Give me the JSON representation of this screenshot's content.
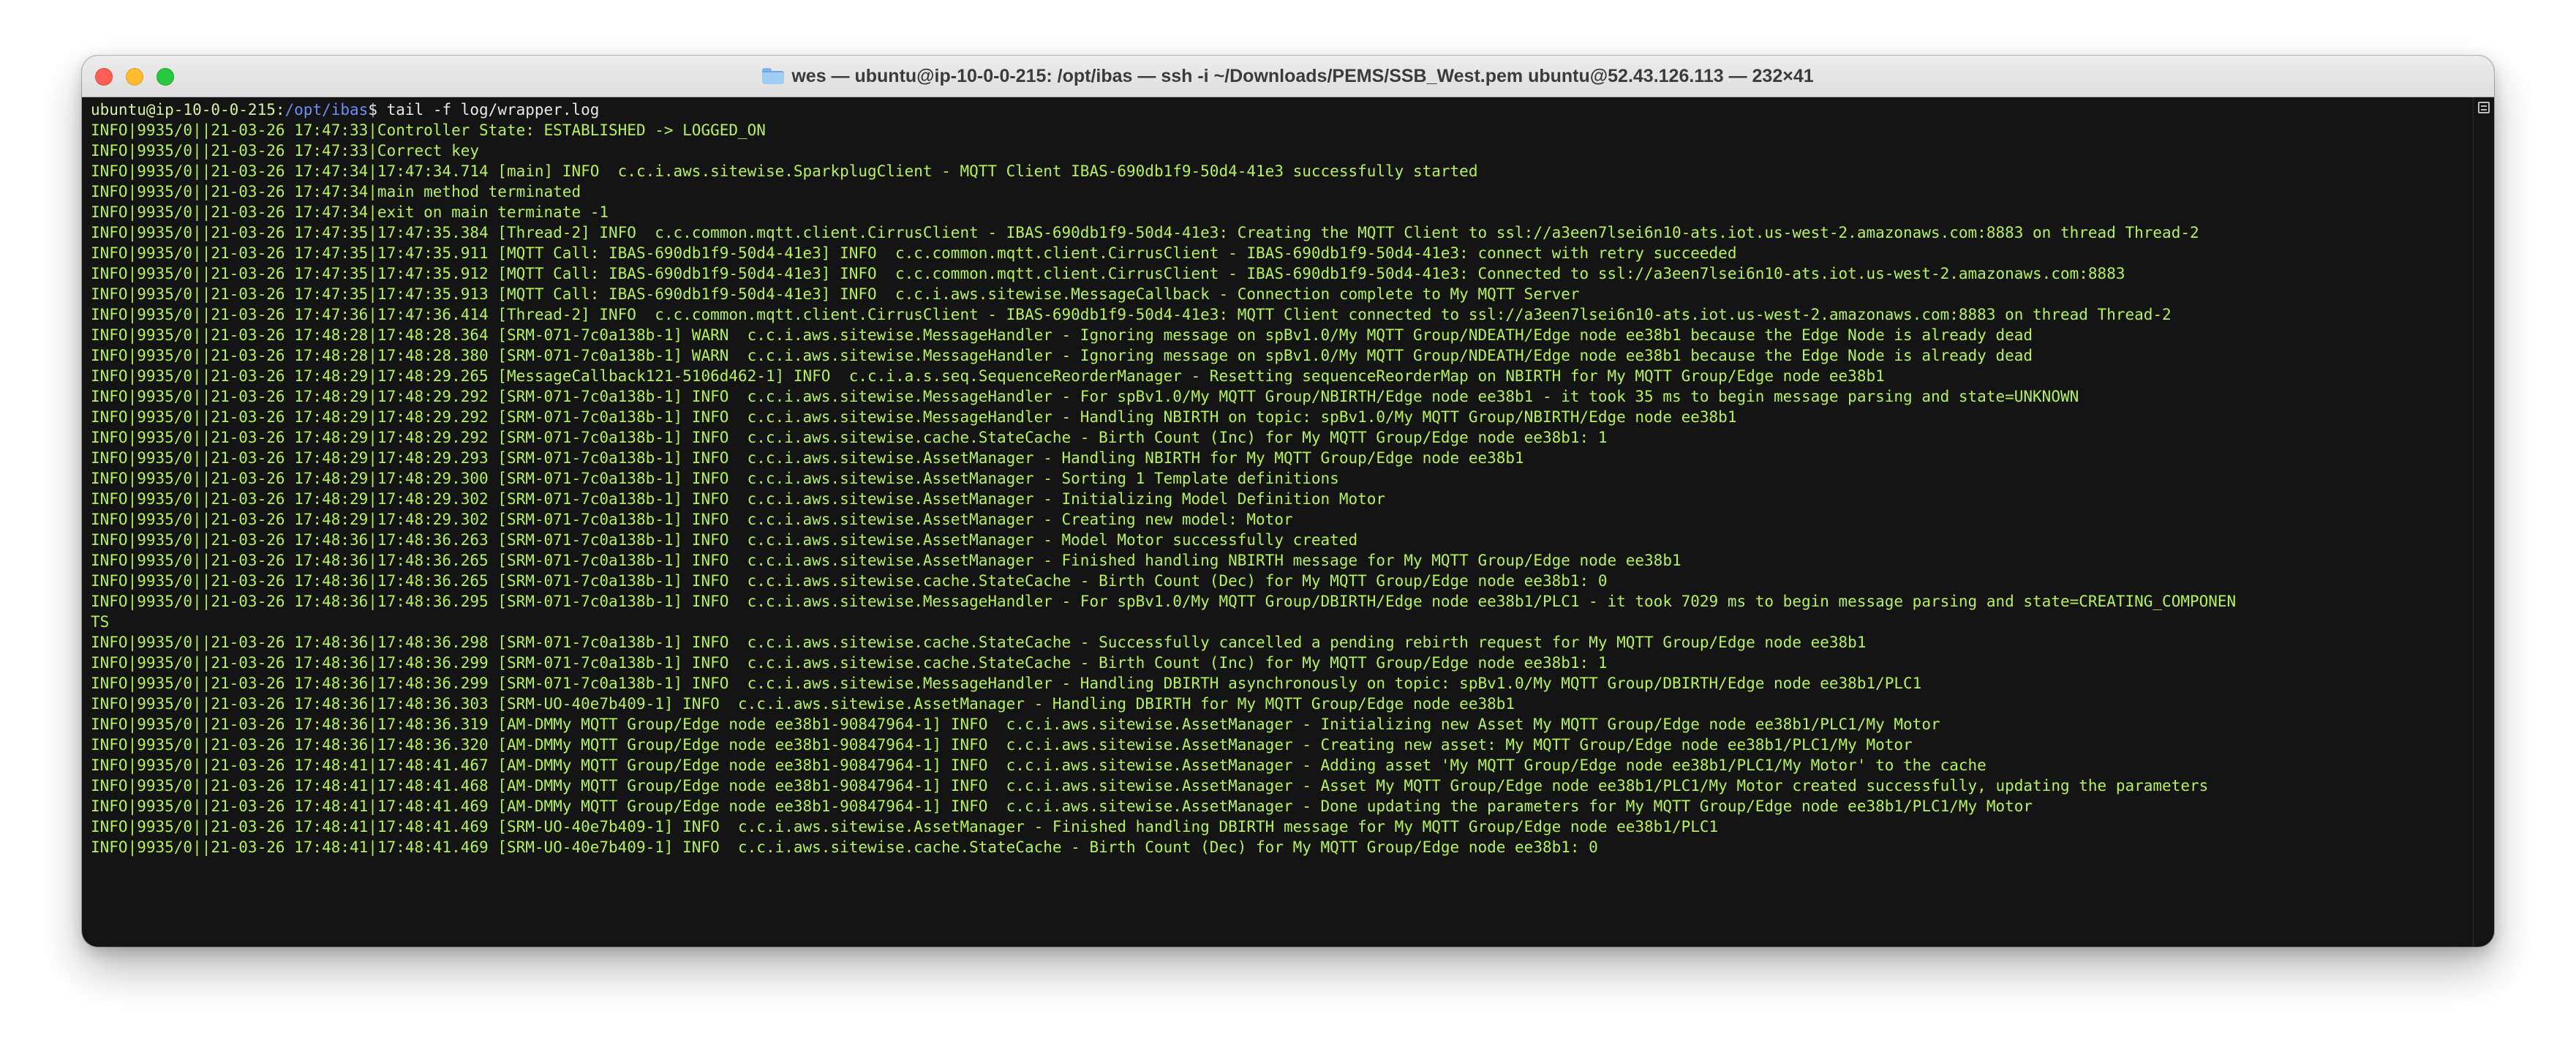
{
  "window": {
    "title": "wes — ubuntu@ip-10-0-0-215: /opt/ibas — ssh -i ~/Downloads/PEMS/SSB_West.pem ubuntu@52.43.126.113 — 232×41"
  },
  "terminal": {
    "prompt": {
      "user_host": "ubuntu@ip-10-0-0-215:",
      "path": "/opt/ibas",
      "symbol": "$",
      "command": " tail -f log/wrapper.log"
    },
    "lines": [
      "INFO|9935/0||21-03-26 17:47:33|Controller State: ESTABLISHED -> LOGGED_ON",
      "INFO|9935/0||21-03-26 17:47:33|Correct key",
      "INFO|9935/0||21-03-26 17:47:34|17:47:34.714 [main] INFO  c.c.i.aws.sitewise.SparkplugClient - MQTT Client IBAS-690db1f9-50d4-41e3 successfully started",
      "INFO|9935/0||21-03-26 17:47:34|main method terminated",
      "INFO|9935/0||21-03-26 17:47:34|exit on main terminate -1",
      "INFO|9935/0||21-03-26 17:47:35|17:47:35.384 [Thread-2] INFO  c.c.common.mqtt.client.CirrusClient - IBAS-690db1f9-50d4-41e3: Creating the MQTT Client to ssl://a3een7lsei6n10-ats.iot.us-west-2.amazonaws.com:8883 on thread Thread-2",
      "INFO|9935/0||21-03-26 17:47:35|17:47:35.911 [MQTT Call: IBAS-690db1f9-50d4-41e3] INFO  c.c.common.mqtt.client.CirrusClient - IBAS-690db1f9-50d4-41e3: connect with retry succeeded",
      "INFO|9935/0||21-03-26 17:47:35|17:47:35.912 [MQTT Call: IBAS-690db1f9-50d4-41e3] INFO  c.c.common.mqtt.client.CirrusClient - IBAS-690db1f9-50d4-41e3: Connected to ssl://a3een7lsei6n10-ats.iot.us-west-2.amazonaws.com:8883",
      "INFO|9935/0||21-03-26 17:47:35|17:47:35.913 [MQTT Call: IBAS-690db1f9-50d4-41e3] INFO  c.c.i.aws.sitewise.MessageCallback - Connection complete to My MQTT Server",
      "INFO|9935/0||21-03-26 17:47:36|17:47:36.414 [Thread-2] INFO  c.c.common.mqtt.client.CirrusClient - IBAS-690db1f9-50d4-41e3: MQTT Client connected to ssl://a3een7lsei6n10-ats.iot.us-west-2.amazonaws.com:8883 on thread Thread-2",
      "INFO|9935/0||21-03-26 17:48:28|17:48:28.364 [SRM-071-7c0a138b-1] WARN  c.c.i.aws.sitewise.MessageHandler - Ignoring message on spBv1.0/My MQTT Group/NDEATH/Edge node ee38b1 because the Edge Node is already dead",
      "INFO|9935/0||21-03-26 17:48:28|17:48:28.380 [SRM-071-7c0a138b-1] WARN  c.c.i.aws.sitewise.MessageHandler - Ignoring message on spBv1.0/My MQTT Group/NDEATH/Edge node ee38b1 because the Edge Node is already dead",
      "INFO|9935/0||21-03-26 17:48:29|17:48:29.265 [MessageCallback121-5106d462-1] INFO  c.c.i.a.s.seq.SequenceReorderManager - Resetting sequenceReorderMap on NBIRTH for My MQTT Group/Edge node ee38b1",
      "INFO|9935/0||21-03-26 17:48:29|17:48:29.292 [SRM-071-7c0a138b-1] INFO  c.c.i.aws.sitewise.MessageHandler - For spBv1.0/My MQTT Group/NBIRTH/Edge node ee38b1 - it took 35 ms to begin message parsing and state=UNKNOWN",
      "INFO|9935/0||21-03-26 17:48:29|17:48:29.292 [SRM-071-7c0a138b-1] INFO  c.c.i.aws.sitewise.MessageHandler - Handling NBIRTH on topic: spBv1.0/My MQTT Group/NBIRTH/Edge node ee38b1",
      "INFO|9935/0||21-03-26 17:48:29|17:48:29.292 [SRM-071-7c0a138b-1] INFO  c.c.i.aws.sitewise.cache.StateCache - Birth Count (Inc) for My MQTT Group/Edge node ee38b1: 1",
      "INFO|9935/0||21-03-26 17:48:29|17:48:29.293 [SRM-071-7c0a138b-1] INFO  c.c.i.aws.sitewise.AssetManager - Handling NBIRTH for My MQTT Group/Edge node ee38b1",
      "INFO|9935/0||21-03-26 17:48:29|17:48:29.300 [SRM-071-7c0a138b-1] INFO  c.c.i.aws.sitewise.AssetManager - Sorting 1 Template definitions",
      "INFO|9935/0||21-03-26 17:48:29|17:48:29.302 [SRM-071-7c0a138b-1] INFO  c.c.i.aws.sitewise.AssetManager - Initializing Model Definition Motor",
      "INFO|9935/0||21-03-26 17:48:29|17:48:29.302 [SRM-071-7c0a138b-1] INFO  c.c.i.aws.sitewise.AssetManager - Creating new model: Motor",
      "INFO|9935/0||21-03-26 17:48:36|17:48:36.263 [SRM-071-7c0a138b-1] INFO  c.c.i.aws.sitewise.AssetManager - Model Motor successfully created",
      "INFO|9935/0||21-03-26 17:48:36|17:48:36.265 [SRM-071-7c0a138b-1] INFO  c.c.i.aws.sitewise.AssetManager - Finished handling NBIRTH message for My MQTT Group/Edge node ee38b1",
      "INFO|9935/0||21-03-26 17:48:36|17:48:36.265 [SRM-071-7c0a138b-1] INFO  c.c.i.aws.sitewise.cache.StateCache - Birth Count (Dec) for My MQTT Group/Edge node ee38b1: 0",
      "INFO|9935/0||21-03-26 17:48:36|17:48:36.295 [SRM-071-7c0a138b-1] INFO  c.c.i.aws.sitewise.MessageHandler - For spBv1.0/My MQTT Group/DBIRTH/Edge node ee38b1/PLC1 - it took 7029 ms to begin message parsing and state=CREATING_COMPONEN",
      "TS",
      "INFO|9935/0||21-03-26 17:48:36|17:48:36.298 [SRM-071-7c0a138b-1] INFO  c.c.i.aws.sitewise.cache.StateCache - Successfully cancelled a pending rebirth request for My MQTT Group/Edge node ee38b1",
      "INFO|9935/0||21-03-26 17:48:36|17:48:36.299 [SRM-071-7c0a138b-1] INFO  c.c.i.aws.sitewise.cache.StateCache - Birth Count (Inc) for My MQTT Group/Edge node ee38b1: 1",
      "INFO|9935/0||21-03-26 17:48:36|17:48:36.299 [SRM-071-7c0a138b-1] INFO  c.c.i.aws.sitewise.MessageHandler - Handling DBIRTH asynchronously on topic: spBv1.0/My MQTT Group/DBIRTH/Edge node ee38b1/PLC1",
      "INFO|9935/0||21-03-26 17:48:36|17:48:36.303 [SRM-UO-40e7b409-1] INFO  c.c.i.aws.sitewise.AssetManager - Handling DBIRTH for My MQTT Group/Edge node ee38b1",
      "INFO|9935/0||21-03-26 17:48:36|17:48:36.319 [AM-DMMy MQTT Group/Edge node ee38b1-90847964-1] INFO  c.c.i.aws.sitewise.AssetManager - Initializing new Asset My MQTT Group/Edge node ee38b1/PLC1/My Motor",
      "INFO|9935/0||21-03-26 17:48:36|17:48:36.320 [AM-DMMy MQTT Group/Edge node ee38b1-90847964-1] INFO  c.c.i.aws.sitewise.AssetManager - Creating new asset: My MQTT Group/Edge node ee38b1/PLC1/My Motor",
      "INFO|9935/0||21-03-26 17:48:41|17:48:41.467 [AM-DMMy MQTT Group/Edge node ee38b1-90847964-1] INFO  c.c.i.aws.sitewise.AssetManager - Adding asset 'My MQTT Group/Edge node ee38b1/PLC1/My Motor' to the cache",
      "INFO|9935/0||21-03-26 17:48:41|17:48:41.468 [AM-DMMy MQTT Group/Edge node ee38b1-90847964-1] INFO  c.c.i.aws.sitewise.AssetManager - Asset My MQTT Group/Edge node ee38b1/PLC1/My Motor created successfully, updating the parameters",
      "INFO|9935/0||21-03-26 17:48:41|17:48:41.469 [AM-DMMy MQTT Group/Edge node ee38b1-90847964-1] INFO  c.c.i.aws.sitewise.AssetManager - Done updating the parameters for My MQTT Group/Edge node ee38b1/PLC1/My Motor",
      "INFO|9935/0||21-03-26 17:48:41|17:48:41.469 [SRM-UO-40e7b409-1] INFO  c.c.i.aws.sitewise.AssetManager - Finished handling DBIRTH message for My MQTT Group/Edge node ee38b1/PLC1",
      "INFO|9935/0||21-03-26 17:48:41|17:48:41.469 [SRM-UO-40e7b409-1] INFO  c.c.i.aws.sitewise.cache.StateCache - Birth Count (Dec) for My MQTT Group/Edge node ee38b1: 0"
    ]
  },
  "colors": {
    "terminal_background": "#141414",
    "log_text": "#b6f252",
    "prompt_path": "#6c8ef5",
    "close": "#ff5f57",
    "minimize": "#febc2e",
    "zoom": "#28c840"
  },
  "icons": {
    "title_icon": "folder-icon",
    "scrollbar_widget": "scroll-marker-icon"
  }
}
